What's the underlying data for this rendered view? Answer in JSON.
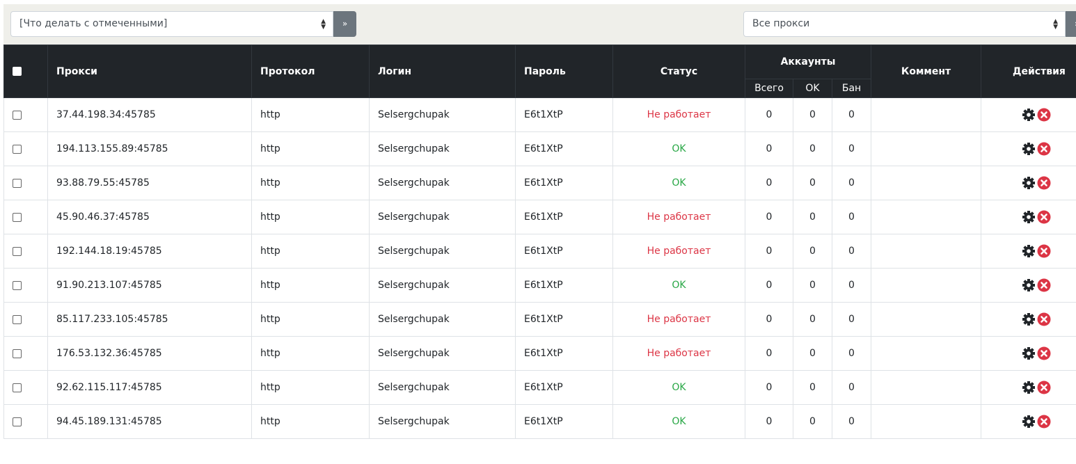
{
  "toolbar": {
    "bulk_action_select": "[Что делать с отмеченными]",
    "bulk_go": "»",
    "filter_select": "Все прокси",
    "filter_go": "»"
  },
  "headers": {
    "proxy": "Прокси",
    "protocol": "Протокол",
    "login": "Логин",
    "password": "Пароль",
    "status": "Статус",
    "accounts": "Аккаунты",
    "total": "Всего",
    "ok": "OK",
    "ban": "Бан",
    "comment": "Коммент",
    "actions": "Действия"
  },
  "colors": {
    "bad": "#dc3545",
    "ok": "#28a745",
    "header": "#212529"
  },
  "rows": [
    {
      "proxy": "37.44.198.34:45785",
      "protocol": "http",
      "login": "Selsergchupak",
      "password": "E6t1XtP",
      "status": "Не работает",
      "state": "bad",
      "total": "0",
      "ok": "0",
      "ban": "0",
      "comment": ""
    },
    {
      "proxy": "194.113.155.89:45785",
      "protocol": "http",
      "login": "Selsergchupak",
      "password": "E6t1XtP",
      "status": "OK",
      "state": "ok",
      "total": "0",
      "ok": "0",
      "ban": "0",
      "comment": ""
    },
    {
      "proxy": "93.88.79.55:45785",
      "protocol": "http",
      "login": "Selsergchupak",
      "password": "E6t1XtP",
      "status": "OK",
      "state": "ok",
      "total": "0",
      "ok": "0",
      "ban": "0",
      "comment": ""
    },
    {
      "proxy": "45.90.46.37:45785",
      "protocol": "http",
      "login": "Selsergchupak",
      "password": "E6t1XtP",
      "status": "Не работает",
      "state": "bad",
      "total": "0",
      "ok": "0",
      "ban": "0",
      "comment": ""
    },
    {
      "proxy": "192.144.18.19:45785",
      "protocol": "http",
      "login": "Selsergchupak",
      "password": "E6t1XtP",
      "status": "Не работает",
      "state": "bad",
      "total": "0",
      "ok": "0",
      "ban": "0",
      "comment": ""
    },
    {
      "proxy": "91.90.213.107:45785",
      "protocol": "http",
      "login": "Selsergchupak",
      "password": "E6t1XtP",
      "status": "OK",
      "state": "ok",
      "total": "0",
      "ok": "0",
      "ban": "0",
      "comment": ""
    },
    {
      "proxy": "85.117.233.105:45785",
      "protocol": "http",
      "login": "Selsergchupak",
      "password": "E6t1XtP",
      "status": "Не работает",
      "state": "bad",
      "total": "0",
      "ok": "0",
      "ban": "0",
      "comment": ""
    },
    {
      "proxy": "176.53.132.36:45785",
      "protocol": "http",
      "login": "Selsergchupak",
      "password": "E6t1XtP",
      "status": "Не работает",
      "state": "bad",
      "total": "0",
      "ok": "0",
      "ban": "0",
      "comment": ""
    },
    {
      "proxy": "92.62.115.117:45785",
      "protocol": "http",
      "login": "Selsergchupak",
      "password": "E6t1XtP",
      "status": "OK",
      "state": "ok",
      "total": "0",
      "ok": "0",
      "ban": "0",
      "comment": ""
    },
    {
      "proxy": "94.45.189.131:45785",
      "protocol": "http",
      "login": "Selsergchupak",
      "password": "E6t1XtP",
      "status": "OK",
      "state": "ok",
      "total": "0",
      "ok": "0",
      "ban": "0",
      "comment": ""
    }
  ]
}
